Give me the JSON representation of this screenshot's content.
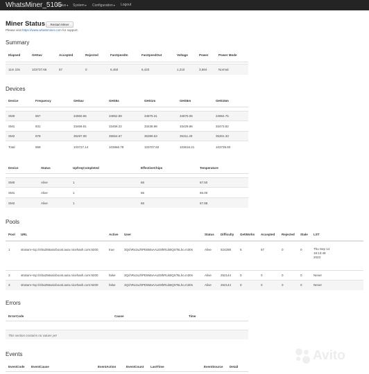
{
  "navbar": {
    "brand": "WhatsMiner_5105",
    "menu": [
      {
        "label": "Status",
        "dropdown": true
      },
      {
        "label": "System",
        "dropdown": true
      },
      {
        "label": "Configuration",
        "dropdown": true
      },
      {
        "label": "Logout",
        "dropdown": false
      }
    ]
  },
  "header": {
    "title": "Miner Status",
    "restart_label": "Restart Miner",
    "support_prefix": "Please visit",
    "support_link": "https://www.whatsminer.com",
    "support_suffix": "for support."
  },
  "summary": {
    "title": "Summary",
    "columns": [
      "Elapsed",
      "GHSav",
      "Accepted",
      "Rejected",
      "FanSpeedIn",
      "FanSpeedOut",
      "Voltage",
      "Power",
      "Power Mode"
    ],
    "rows": [
      [
        "11m 23s",
        "103737.66",
        "57",
        "0",
        "6,450",
        "6,420",
        "1,210",
        "3,584",
        "Normal"
      ]
    ]
  },
  "devices": {
    "title": "Devices",
    "columns": [
      "Device",
      "Frequency",
      "GHSav",
      "GHS5s",
      "GHS1m",
      "GHS5m",
      "GHS15m"
    ],
    "rows": [
      [
        "SM0",
        "867",
        "34960.56",
        "34852.89",
        "34879.31",
        "34875.06",
        "34964.75"
      ],
      [
        "SM1",
        "831",
        "33469.51",
        "33459.22",
        "33438.98",
        "33429.86",
        "33473.52"
      ],
      [
        "SM2",
        "878",
        "35297.08",
        "35554.67",
        "35389.53",
        "35311.29",
        "35301.33"
      ],
      [
        "Total",
        "858",
        "103727.14",
        "103866.78",
        "103707.82",
        "103616.21",
        "103739.60"
      ]
    ]
  },
  "device_status": {
    "columns": [
      "Device",
      "Status",
      "UpfreqCompleted",
      "EffectiveChips",
      "Temperature"
    ],
    "rows": [
      [
        "SM0",
        "Alive",
        "1",
        "66",
        "67.50"
      ],
      [
        "SM1",
        "Alive",
        "1",
        "66",
        "65.00"
      ],
      [
        "SM2",
        "Alive",
        "1",
        "66",
        "67.88"
      ]
    ]
  },
  "pools": {
    "title": "Pools",
    "columns": [
      "Pool",
      "URL",
      "Active",
      "User",
      "Status",
      "Difficulty",
      "GetWorks",
      "Accepted",
      "Rejected",
      "Stale",
      "LST"
    ],
    "rows": [
      [
        "1",
        "stratum+tcp://sha256asicboost.auto.nicehash.com:9200",
        "true",
        "3QchRx2uJhPE6MaAALE8hRLkBQSTsLho.m30s",
        "Alive",
        "524288",
        "6",
        "57",
        "0",
        "0",
        "Thu Sep 14 18:13:49 2023"
      ],
      [
        "2",
        "stratum+tcp://sha256asicboost.auto.nicehash.com:9200",
        "false",
        "3QchRx2uJhPE6MaAALE8hRLkBQSTsLho.m30s",
        "Alive",
        "262144",
        "0",
        "0",
        "0",
        "0",
        "Never"
      ],
      [
        "3",
        "stratum+tcp://sha256asicboost.auto.nicehash.com:9200",
        "false",
        "3QchRx2uJhPE6MaAALE8hRLkBQSTsLho.m30s",
        "Alive",
        "262144",
        "0",
        "0",
        "0",
        "0",
        "Never"
      ]
    ]
  },
  "errors": {
    "title": "Errors",
    "columns": [
      "ErrorCode",
      "Cause",
      "Time"
    ],
    "empty_note": "This section contains no values yet"
  },
  "events": {
    "title": "Events",
    "columns": [
      "EventCode",
      "EventCause",
      "EventAction",
      "EventCount",
      "LastTime",
      "EventSource",
      "Detail"
    ]
  },
  "watermark": "Avito"
}
